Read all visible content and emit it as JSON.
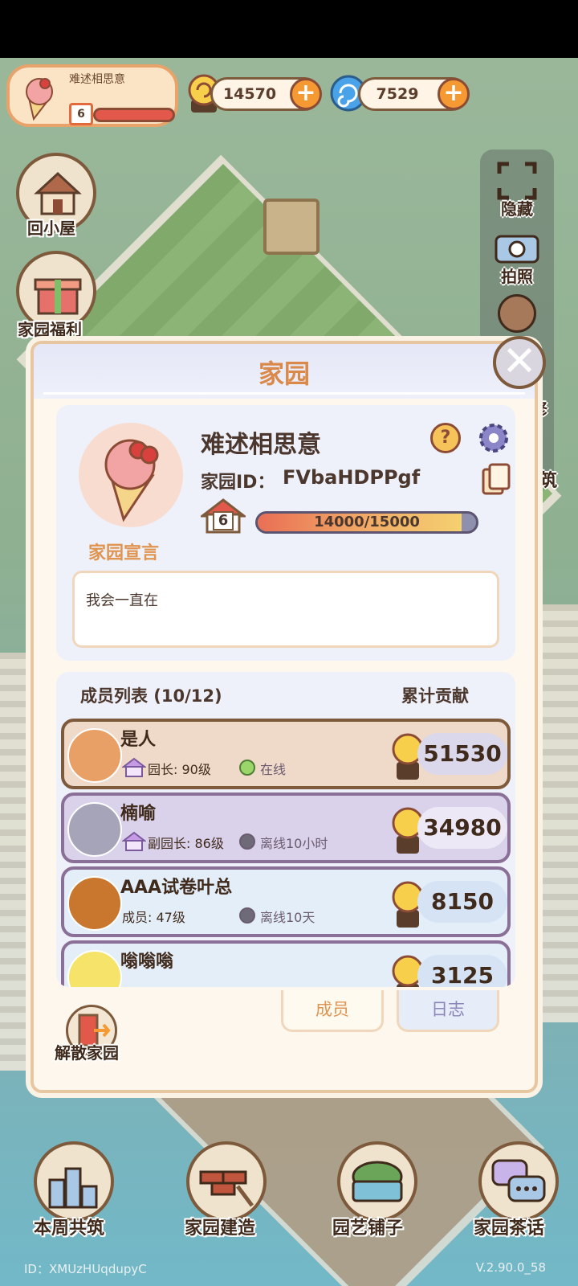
{
  "hud": {
    "player_name": "难述相思意",
    "player_level": "6",
    "coins": "14570",
    "gems": "7529"
  },
  "left_menu": [
    {
      "label": "回小屋"
    },
    {
      "label": "家园福利"
    }
  ],
  "right_toolbar": [
    {
      "label": "隐藏"
    },
    {
      "label": "拍照"
    },
    {
      "label": "修"
    },
    {
      "label": "筑"
    }
  ],
  "modal": {
    "title": "家园",
    "home_name": "难述相思意",
    "home_id_label": "家园ID：",
    "home_id_value": "FVbaHDPPgf",
    "level": "6",
    "xp_text": "14000/15000",
    "xp_fraction": 0.933,
    "declaration_label": "家园宣言",
    "declaration_text": "我会一直在",
    "members_title": "成员列表 (10/12)",
    "contrib_title": "累计贡献",
    "members": [
      {
        "name": "是人",
        "role": "园长: 90级",
        "status": "在线",
        "score": "51530"
      },
      {
        "name": "楠喻",
        "role": "副园长: 86级",
        "status": "离线10小时",
        "score": "34980"
      },
      {
        "name": "AAA试卷叶总",
        "role": "成员: 47级",
        "status": "离线10天",
        "score": "8150"
      },
      {
        "name": "嗡嗡嗡",
        "role": "",
        "status": "",
        "score": "3125"
      }
    ],
    "tabs": [
      {
        "label": "成员"
      },
      {
        "label": "日志"
      }
    ],
    "dissolve_label": "解散家园"
  },
  "bottom_nav": [
    {
      "label": "本周共筑"
    },
    {
      "label": "家园建造"
    },
    {
      "label": "园艺铺子"
    },
    {
      "label": "家园茶话"
    }
  ],
  "footer": {
    "id_text": "ID：XMUzHUqdupyC",
    "version": "V.2.90.0_58"
  }
}
